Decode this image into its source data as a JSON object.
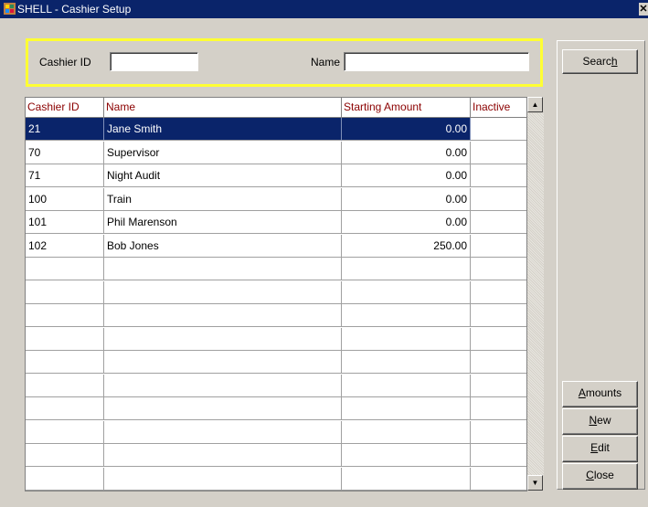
{
  "window": {
    "title": "SHELL - Cashier Setup",
    "close_glyph": "✕"
  },
  "search": {
    "cashier_id_label": "Cashier ID",
    "cashier_id_value": "",
    "name_label": "Name",
    "name_value": ""
  },
  "grid": {
    "columns": [
      "Cashier ID",
      "Name",
      "Starting Amount",
      "Inactive"
    ],
    "rows": [
      {
        "id": "21",
        "name": "Jane Smith",
        "amount": "0.00",
        "inactive": "",
        "selected": true
      },
      {
        "id": "70",
        "name": "Supervisor",
        "amount": "0.00",
        "inactive": ""
      },
      {
        "id": "71",
        "name": "Night Audit",
        "amount": "0.00",
        "inactive": ""
      },
      {
        "id": "100",
        "name": "Train",
        "amount": "0.00",
        "inactive": ""
      },
      {
        "id": "101",
        "name": "Phil Marenson",
        "amount": "0.00",
        "inactive": ""
      },
      {
        "id": "102",
        "name": "Bob Jones",
        "amount": "250.00",
        "inactive": ""
      }
    ],
    "empty_rows": 10,
    "header_color": "#8b0000",
    "selection_color": "#0a246a"
  },
  "buttons": {
    "search": {
      "pre": "Searc",
      "key": "h",
      "post": ""
    },
    "amounts": {
      "pre": "",
      "key": "A",
      "post": "mounts"
    },
    "new": {
      "pre": "",
      "key": "N",
      "post": "ew"
    },
    "edit": {
      "pre": "",
      "key": "E",
      "post": "dit"
    },
    "close": {
      "pre": "",
      "key": "C",
      "post": "lose"
    }
  },
  "icons": {
    "window": "app-window-icon",
    "scroll_up": "scroll-up-arrow-icon",
    "scroll_down": "scroll-down-arrow-icon"
  },
  "colors": {
    "titlebar": "#0a246a",
    "search_highlight": "#ffff33",
    "window_bg": "#d4d0c8"
  }
}
